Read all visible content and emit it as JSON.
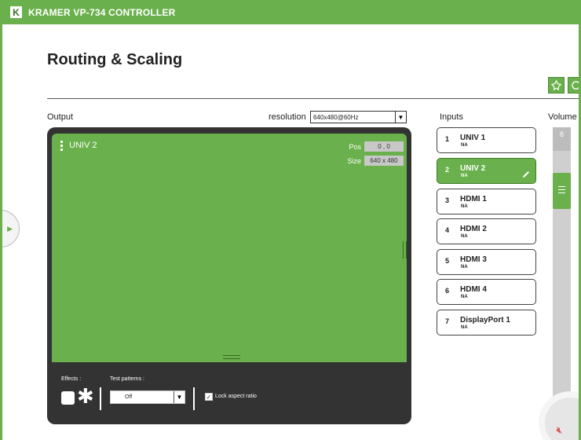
{
  "header": {
    "logo": "K",
    "title": "KRAMER VP-734  CONTROLLER"
  },
  "page": {
    "title": "Routing & Scaling"
  },
  "toolbar": {
    "icons": [
      "pin-icon",
      "refresh-icon"
    ]
  },
  "output": {
    "label": "Output",
    "resolution_label": "resolution",
    "resolution_value": "640x480@60Hz",
    "source_name": "UNIV 2",
    "pos_label": "Pos",
    "pos_value": "0 , 0",
    "size_label": "Size",
    "size_value": "640 x 480",
    "effects_label": "Effects :",
    "effect_icons": [
      "white-square-icon",
      "asterisk-icon"
    ],
    "test_patterns_label": "Test patterns :",
    "test_pattern_value": "Off",
    "lock_aspect_label": "Lock aspect ratio",
    "lock_aspect_checked": true
  },
  "inputs": {
    "label": "Inputs",
    "items": [
      {
        "num": "1",
        "name": "UNIV 1",
        "status": "NA",
        "active": false
      },
      {
        "num": "2",
        "name": "UNIV 2",
        "status": "NA",
        "active": true
      },
      {
        "num": "3",
        "name": "HDMI 1",
        "status": "NA",
        "active": false
      },
      {
        "num": "4",
        "name": "HDMI 2",
        "status": "NA",
        "active": false
      },
      {
        "num": "5",
        "name": "HDMI 3",
        "status": "NA",
        "active": false
      },
      {
        "num": "6",
        "name": "HDMI 4",
        "status": "NA",
        "active": false
      },
      {
        "num": "7",
        "name": "DisplayPort 1",
        "status": "NA",
        "active": false
      }
    ]
  },
  "volume": {
    "label": "Volume",
    "value": "8",
    "mute_icon": "mute-icon"
  },
  "colors": {
    "accent": "#6ab04c",
    "panel": "#333333"
  }
}
